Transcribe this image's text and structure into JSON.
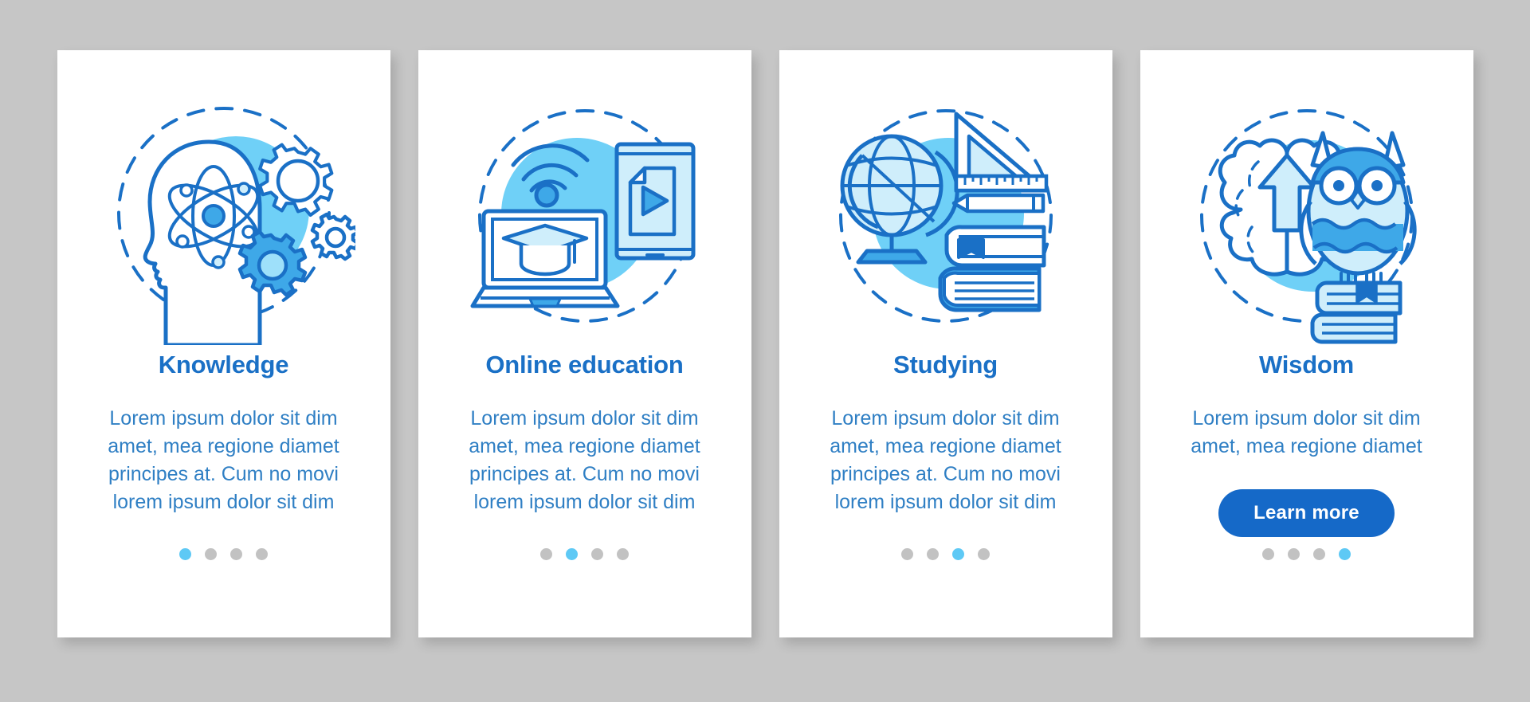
{
  "page": {
    "background_color": "#c6c6c6",
    "card_background": "#ffffff",
    "title_color": "#1a70c6",
    "body_color": "#2f7fc4",
    "accent_color": "#1569c8",
    "dot_active_color": "#5ec9f5",
    "dot_inactive_color": "#c2c2c2",
    "illustration_blue": "#5ec9f5",
    "illustration_stroke": "#1a70c6"
  },
  "cards": [
    {
      "icon_name": "head-atom-gears-icon",
      "title": "Knowledge",
      "body": "Lorem ipsum dolor sit dim amet, mea regione diamet principes at. Cum no movi lorem ipsum dolor sit dim",
      "has_button": false,
      "button_label": "",
      "dots": [
        true,
        false,
        false,
        false
      ],
      "active_dot_index": 0
    },
    {
      "icon_name": "laptop-wifi-tablet-icon",
      "title": "Online education",
      "body": "Lorem ipsum dolor sit dim amet, mea regione diamet principes at. Cum no movi lorem ipsum dolor sit dim",
      "has_button": false,
      "button_label": "",
      "dots": [
        false,
        true,
        false,
        false
      ],
      "active_dot_index": 1
    },
    {
      "icon_name": "globe-books-ruler-icon",
      "title": "Studying",
      "body": "Lorem ipsum dolor sit dim amet, mea regione diamet principes at. Cum no movi lorem ipsum dolor sit dim",
      "has_button": false,
      "button_label": "",
      "dots": [
        false,
        false,
        true,
        false
      ],
      "active_dot_index": 2
    },
    {
      "icon_name": "brain-owl-books-icon",
      "title": "Wisdom",
      "body": "Lorem ipsum dolor sit dim amet, mea regione diamet",
      "has_button": true,
      "button_label": "Learn more",
      "dots": [
        false,
        false,
        false,
        true
      ],
      "active_dot_index": 3
    }
  ]
}
